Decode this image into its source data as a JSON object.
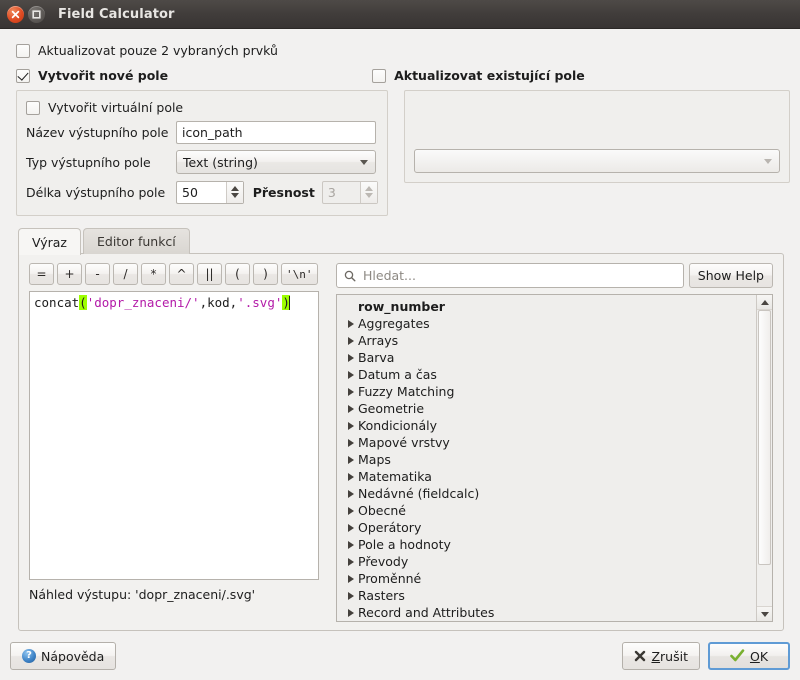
{
  "window": {
    "title": "Field Calculator",
    "close_icon": "close-icon",
    "maximize_icon": "maximize-icon"
  },
  "options": {
    "update_selected": {
      "label": "Aktualizovat pouze 2 vybraných prvků",
      "checked": false
    },
    "create_new_field": {
      "label": "Vytvořit nové pole",
      "checked": true
    },
    "update_existing_field": {
      "label": "Aktualizovat existující pole",
      "checked": false
    },
    "create_virtual_field": {
      "label": "Vytvořit virtuální pole",
      "checked": false
    }
  },
  "new_field": {
    "name_label": "Název výstupního pole",
    "name_value": "icon_path",
    "type_label": "Typ výstupního pole",
    "type_value": "Text (string)",
    "length_label": "Délka výstupního pole",
    "length_value": "50",
    "precision_label": "Přesnost",
    "precision_value": "3"
  },
  "existing_field": {
    "selected_value": ""
  },
  "tabs": [
    {
      "label": "Výraz",
      "active": true
    },
    {
      "label": "Editor funkcí",
      "active": false
    }
  ],
  "operators": [
    {
      "label": "=",
      "name": "operator-equals"
    },
    {
      "label": "+",
      "name": "operator-plus"
    },
    {
      "label": "-",
      "name": "operator-minus"
    },
    {
      "label": "/",
      "name": "operator-divide"
    },
    {
      "label": "*",
      "name": "operator-multiply"
    },
    {
      "label": "^",
      "name": "operator-power"
    },
    {
      "label": "||",
      "name": "operator-concat"
    },
    {
      "label": "(",
      "name": "operator-open-paren"
    },
    {
      "label": ")",
      "name": "operator-close-paren"
    },
    {
      "label": "'\\n'",
      "name": "operator-newline"
    }
  ],
  "expression": {
    "tokens": [
      {
        "text": "concat",
        "type": "plain"
      },
      {
        "text": "(",
        "type": "paren"
      },
      {
        "text": "'dopr_znaceni/'",
        "type": "string"
      },
      {
        "text": ",kod,",
        "type": "plain"
      },
      {
        "text": "'.svg'",
        "type": "string"
      },
      {
        "text": ")",
        "type": "paren"
      }
    ],
    "full_text": "concat('dopr_znaceni/',kod,'.svg')"
  },
  "preview": {
    "text": "Náhled výstupu: 'dopr_znaceni/.svg'"
  },
  "search": {
    "placeholder": "Hledat...",
    "icon": "search-icon"
  },
  "show_help_button": {
    "label": "Show Help"
  },
  "function_tree": [
    {
      "label": "row_number",
      "expandable": false,
      "bold": true
    },
    {
      "label": "Aggregates",
      "expandable": true,
      "bold": false
    },
    {
      "label": "Arrays",
      "expandable": true,
      "bold": false
    },
    {
      "label": "Barva",
      "expandable": true,
      "bold": false
    },
    {
      "label": "Datum a čas",
      "expandable": true,
      "bold": false
    },
    {
      "label": "Fuzzy Matching",
      "expandable": true,
      "bold": false
    },
    {
      "label": "Geometrie",
      "expandable": true,
      "bold": false
    },
    {
      "label": "Kondicionály",
      "expandable": true,
      "bold": false
    },
    {
      "label": "Mapové vrstvy",
      "expandable": true,
      "bold": false
    },
    {
      "label": "Maps",
      "expandable": true,
      "bold": false
    },
    {
      "label": "Matematika",
      "expandable": true,
      "bold": false
    },
    {
      "label": "Nedávné (fieldcalc)",
      "expandable": true,
      "bold": false
    },
    {
      "label": "Obecné",
      "expandable": true,
      "bold": false
    },
    {
      "label": "Operátory",
      "expandable": true,
      "bold": false
    },
    {
      "label": "Pole a hodnoty",
      "expandable": true,
      "bold": false
    },
    {
      "label": "Převody",
      "expandable": true,
      "bold": false
    },
    {
      "label": "Proměnné",
      "expandable": true,
      "bold": false
    },
    {
      "label": "Rasters",
      "expandable": true,
      "bold": false
    },
    {
      "label": "Record and Attributes",
      "expandable": true,
      "bold": false
    }
  ],
  "footer": {
    "help_label": "Nápověda",
    "cancel_label": "Zrušit",
    "cancel_mnemonic": "Z",
    "cancel_rest": "rušit",
    "ok_label": "OK",
    "ok_mnemonic": "O",
    "ok_rest": "K"
  },
  "colors": {
    "titlebar": "#413d3b",
    "background": "#f2f1f0",
    "paren_highlight": "#9dff00",
    "string_token": "#b31aa8",
    "focus_border": "#5f9bd5",
    "check_green": "#73ae2a"
  }
}
